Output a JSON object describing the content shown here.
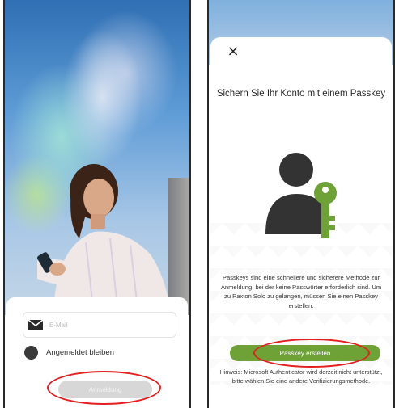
{
  "login_screen": {
    "email_placeholder": "E-Mail",
    "remember_label": "Angemeldet bleiben",
    "login_button": "Anmeldung"
  },
  "passkey_screen": {
    "close_icon": "×",
    "title": "Sichern Sie Ihr Konto mit einem Passkey",
    "description": "Passkeys sind eine schnellere und sicherere Methode zur Anmeldung, bei der keine Passwörter erforderlich sind. Um zu Paxton Solo zu gelangen, müssen Sie einen Passkey erstellen.",
    "create_button": "Passkey erstellen",
    "hint": "Hinweis: Microsoft Authenticator wird derzeit nicht unterstützt, bitte wählen Sie eine andere Verifizierungsmethode."
  },
  "colors": {
    "accent_green": "#6ea136",
    "highlight_red": "#e32020",
    "icon_dark": "#333333"
  }
}
